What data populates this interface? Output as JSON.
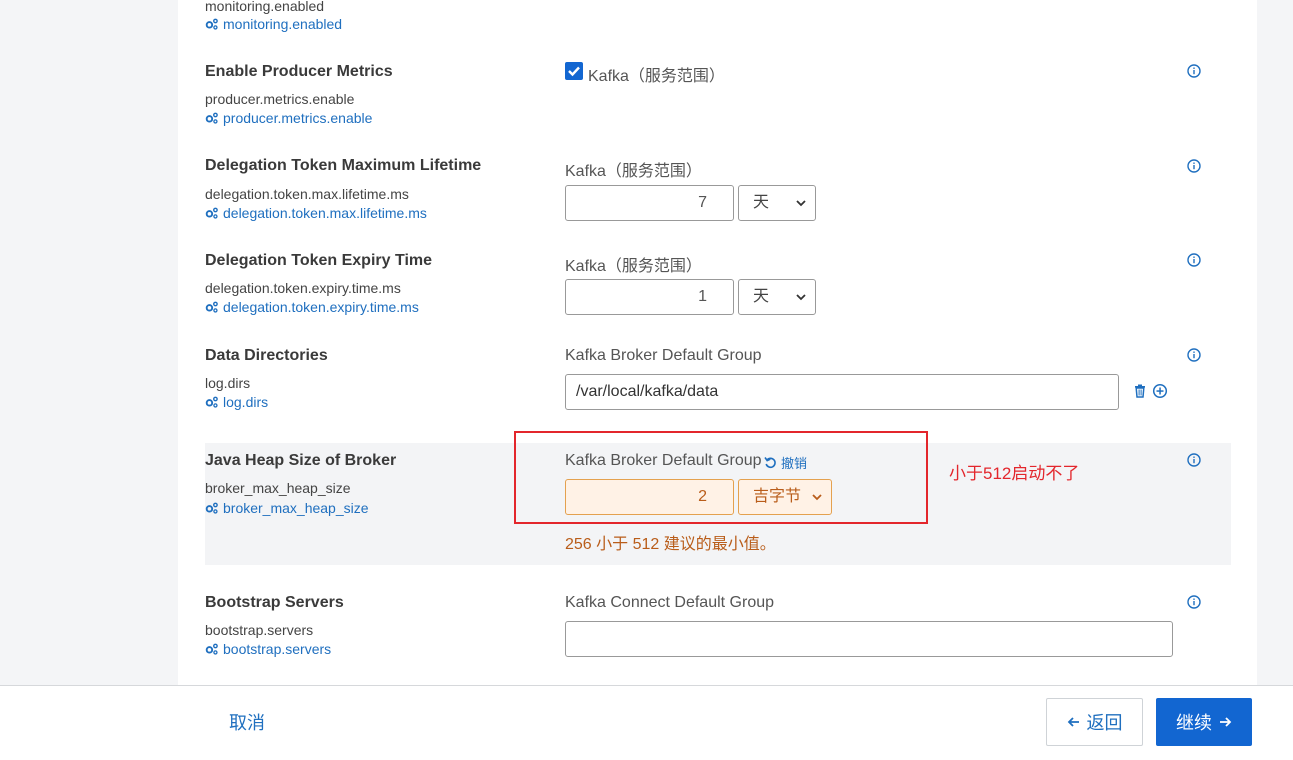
{
  "footer": {
    "cancel_label": "取消",
    "back_label": "返回",
    "next_label": "继续"
  },
  "top_partial": {
    "key": "monitoring.enabled",
    "link": "monitoring.enabled"
  },
  "props": [
    {
      "title": "Enable Producer Metrics",
      "key": "producer.metrics.enable",
      "link": "producer.metrics.enable",
      "scope": "Kafka（服务范围）",
      "checked": true
    },
    {
      "title": "Delegation Token Maximum Lifetime",
      "key": "delegation.token.max.lifetime.ms",
      "link": "delegation.token.max.lifetime.ms",
      "scope": "Kafka（服务范围）",
      "value": "7",
      "unit": "天"
    },
    {
      "title": "Delegation Token Expiry Time",
      "key": "delegation.token.expiry.time.ms",
      "link": "delegation.token.expiry.time.ms",
      "scope": "Kafka（服务范围）",
      "value": "1",
      "unit": "天"
    },
    {
      "title": "Data Directories",
      "key": "log.dirs",
      "link": "log.dirs",
      "scope": "Kafka Broker Default Group",
      "value": "/var/local/kafka/data"
    },
    {
      "title": "Java Heap Size of Broker",
      "key": "broker_max_heap_size",
      "link": "broker_max_heap_size",
      "scope": "Kafka Broker Default Group",
      "undo_label": "撤销",
      "value": "2",
      "unit": "吉字节",
      "warning": "256 小于 512 建议的最小值。"
    },
    {
      "title": "Bootstrap Servers",
      "key": "bootstrap.servers",
      "link": "bootstrap.servers",
      "scope": "Kafka Connect Default Group",
      "value": ""
    }
  ],
  "annotation": "小于512启动不了",
  "colors": {
    "link": "#1f6fbf",
    "primary": "#1266d1",
    "warning": "#b95d1a",
    "annotation_red": "#e3262c"
  }
}
